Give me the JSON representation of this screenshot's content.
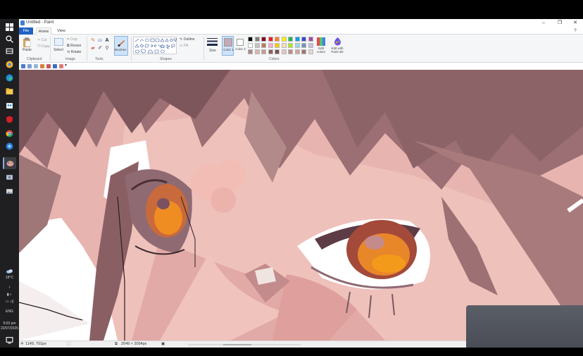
{
  "window": {
    "title": "Untitled - Paint",
    "minimize": "–",
    "maximize": "❐",
    "close": "✕"
  },
  "tabs": {
    "file": "File",
    "home": "Home",
    "view": "View"
  },
  "ribbon": {
    "clipboard": {
      "label": "Clipboard",
      "paste": "Paste",
      "cut": "Cut",
      "copy": "Copy"
    },
    "image": {
      "label": "Image",
      "select": "Select",
      "crop": "Crop",
      "resize": "Resize",
      "rotate": "Rotate"
    },
    "tools": {
      "label": "Tools"
    },
    "brushes": {
      "label": "Brushes"
    },
    "shapes": {
      "label": "Shapes",
      "outline": "Outline",
      "fill": "Fill"
    },
    "size": {
      "label": "Size"
    },
    "color1": {
      "label": "Color 1",
      "hex": "#c4a9b8"
    },
    "color2": {
      "label": "Color 2",
      "hex": "#ffffff"
    },
    "colors": {
      "label": "Colors",
      "row1": [
        "#000000",
        "#7f7f7f",
        "#880015",
        "#ed1c24",
        "#ff7f27",
        "#fff200",
        "#22b14c",
        "#00a2e8",
        "#3f48cc",
        "#a349a4"
      ],
      "row2": [
        "#ffffff",
        "#c3c3c3",
        "#b97a57",
        "#ffaec9",
        "#ffc90e",
        "#efe4b0",
        "#b5e61d",
        "#99d9ea",
        "#7092be",
        "#c8bfe7"
      ],
      "row3": [
        "#a88a86",
        "#d6b8b2",
        "#c49a97",
        "#8c5f5f",
        "#7a4e55",
        "#e2c7bf",
        "#b98e8b",
        "#cfa6a3",
        "#9b7574",
        "#e9d6d0"
      ]
    },
    "edit_colors": "Edit colors",
    "edit_paint3d": "Edit with Paint 3D"
  },
  "status": {
    "cursor_pos": "1149, 701px",
    "image_size": "2049 × 2054px"
  },
  "taskbar": {
    "weather": "18°C",
    "language": "ENG",
    "time": "9:03 pm",
    "date": "22/07/2025"
  }
}
